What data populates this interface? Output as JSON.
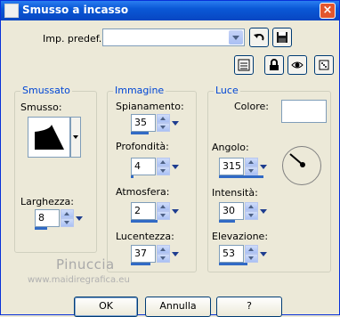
{
  "window": {
    "title": "Smusso a incasso"
  },
  "preset": {
    "label": "Imp. predef.:",
    "value": ""
  },
  "groups": {
    "smussato": {
      "title": "Smussato",
      "smusso_label": "Smusso:",
      "larghezza_label": "Larghezza:",
      "larghezza_value": "8"
    },
    "immagine": {
      "title": "Immagine",
      "spianamento_label": "Spianamento:",
      "spianamento_value": "35",
      "profondita_label": "Profondità:",
      "profondita_value": "4",
      "atmosfera_label": "Atmosfera:",
      "atmosfera_value": "2",
      "lucentezza_label": "Lucentezza:",
      "lucentezza_value": "37"
    },
    "luce": {
      "title": "Luce",
      "colore_label": "Colore:",
      "colore_value": "#ffffff",
      "angolo_label": "Angolo:",
      "angolo_value": "315",
      "intensita_label": "Intensità:",
      "intensita_value": "30",
      "elevazione_label": "Elevazione:",
      "elevazione_value": "53"
    }
  },
  "watermark": {
    "name": "Pinuccia",
    "url": "www.maidiregrafica.eu"
  },
  "buttons": {
    "ok": "OK",
    "annulla": "Annulla",
    "help": "?"
  },
  "icons": {
    "close": "close-icon",
    "undo": "undo-arrow-icon",
    "save": "save-disk-icon",
    "presets": "preset-list-icon",
    "lock": "lock-icon",
    "eye": "eye-icon",
    "randomize": "dice-icon"
  },
  "colors": {
    "title_bar": "#0a58d6",
    "group_title": "#0046d5",
    "window_bg": "#ece9d8"
  }
}
